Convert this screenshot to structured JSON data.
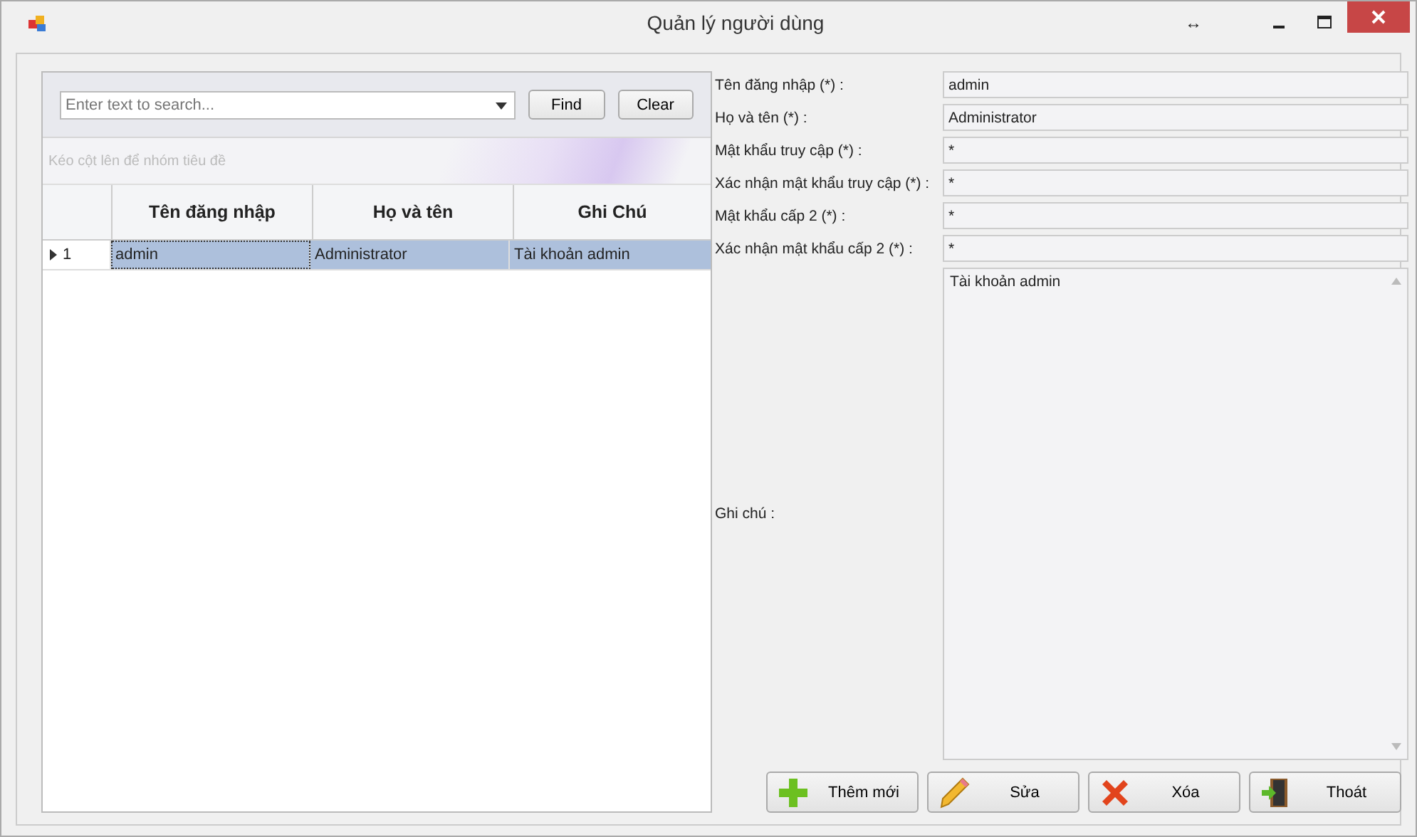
{
  "window": {
    "title": "Quản lý người dùng",
    "controls": [
      "↔"
    ]
  },
  "search": {
    "placeholder": "Enter text to search...",
    "buttons": [
      "Find",
      "Clear"
    ]
  },
  "group_panel": {
    "hint": "Kéo cột lên để nhóm tiêu đề"
  },
  "table": {
    "columns": [
      "Tên đăng nhập",
      "Họ và tên",
      "Ghi Chú"
    ],
    "rows": [
      {
        "indicator": "1",
        "selected": true,
        "cells": [
          "admin",
          "Administrator",
          "Tài khoản admin"
        ]
      }
    ]
  },
  "form": {
    "fields": [
      {
        "label": "Tên đăng nhập (*) :",
        "value": "admin"
      },
      {
        "label": "Họ và tên (*) :",
        "value": "Administrator"
      },
      {
        "label": "Mật khẩu truy cập (*) :",
        "value": "*"
      },
      {
        "label": "Xác nhận mật khẩu truy cập (*) :",
        "value": "*"
      },
      {
        "label": "Mật khẩu cấp 2 (*) :",
        "value": "*"
      },
      {
        "label": "Xác nhận mật khẩu cấp 2 (*) :",
        "value": "*"
      }
    ],
    "note": {
      "label": "Ghi chú :",
      "value": "Tài khoản admin"
    }
  },
  "buttons": [
    {
      "kind": "add",
      "label": "Thêm mới"
    },
    {
      "kind": "edit",
      "label": "Sửa"
    },
    {
      "kind": "delete",
      "label": "Xóa"
    },
    {
      "kind": "exit",
      "label": "Thoát"
    }
  ]
}
